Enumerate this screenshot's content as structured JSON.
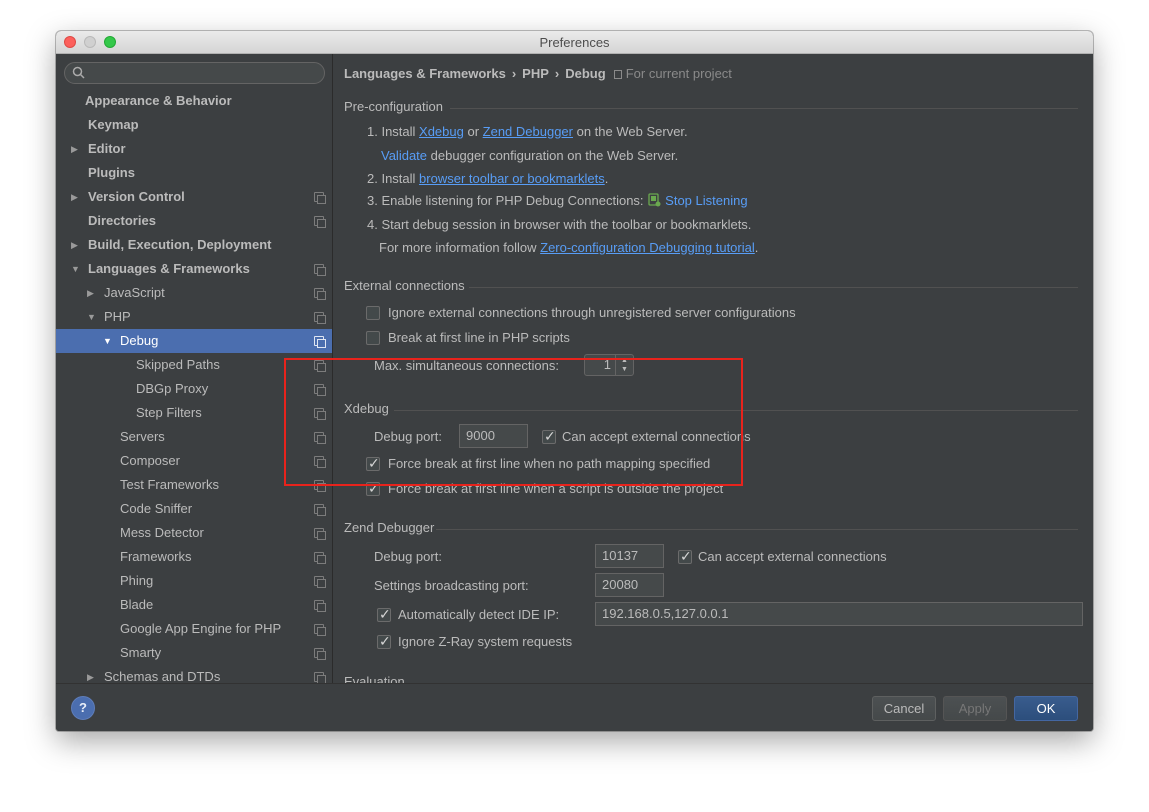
{
  "window": {
    "title": "Preferences"
  },
  "sidebar": {
    "search_placeholder": "",
    "items": [
      {
        "label": "Appearance & Behavior",
        "arrow": "",
        "bold": true
      },
      {
        "label": "Keymap",
        "arrow": "",
        "bold": true
      },
      {
        "label": "Editor",
        "arrow": "▶",
        "bold": true
      },
      {
        "label": "Plugins",
        "arrow": "",
        "bold": true
      },
      {
        "label": "Version Control",
        "arrow": "▶",
        "bold": true
      },
      {
        "label": "Directories",
        "arrow": "",
        "bold": true
      },
      {
        "label": "Build, Execution, Deployment",
        "arrow": "▶",
        "bold": true
      },
      {
        "label": "Languages & Frameworks",
        "arrow": "▼",
        "bold": true
      },
      {
        "label": "JavaScript",
        "arrow": "▶"
      },
      {
        "label": "PHP",
        "arrow": "▼"
      },
      {
        "label": "Debug",
        "arrow": "▼",
        "selected": true
      },
      {
        "label": "Skipped Paths",
        "arrow": ""
      },
      {
        "label": "DBGp Proxy",
        "arrow": ""
      },
      {
        "label": "Step Filters",
        "arrow": ""
      },
      {
        "label": "Servers",
        "arrow": ""
      },
      {
        "label": "Composer",
        "arrow": ""
      },
      {
        "label": "Test Frameworks",
        "arrow": ""
      },
      {
        "label": "Code Sniffer",
        "arrow": ""
      },
      {
        "label": "Mess Detector",
        "arrow": ""
      },
      {
        "label": "Frameworks",
        "arrow": ""
      },
      {
        "label": "Phing",
        "arrow": ""
      },
      {
        "label": "Blade",
        "arrow": ""
      },
      {
        "label": "Google App Engine for PHP",
        "arrow": ""
      },
      {
        "label": "Smarty",
        "arrow": ""
      },
      {
        "label": "Schemas and DTDs",
        "arrow": "▶"
      }
    ]
  },
  "breadcrumb": {
    "part1": "Languages & Frameworks",
    "part2": "PHP",
    "part3": "Debug",
    "sep": "›",
    "scope": "For current project"
  },
  "preconfig": {
    "title": "Pre-configuration",
    "step1_prefix": "1. Install ",
    "step1_link1": "Xdebug",
    "step1_or": " or ",
    "step1_link2": "Zend Debugger",
    "step1_suffix": " on the Web Server.",
    "validate_link": "Validate",
    "validate_suffix": " debugger configuration on the Web Server.",
    "step2_prefix": "2. Install ",
    "step2_link": "browser toolbar or bookmarklets",
    "step2_suffix": ".",
    "step3_prefix": "3. Enable listening for PHP Debug Connections: ",
    "step3_link": "Stop Listening",
    "step4": "4. Start debug session in browser with the toolbar or bookmarklets.",
    "more_prefix": "For more information follow ",
    "more_link": "Zero-configuration Debugging tutorial",
    "more_suffix": "."
  },
  "external": {
    "title": "External connections",
    "ignore_label": "Ignore external connections through unregistered server configurations",
    "ignore_checked": false,
    "break_label": "Break at first line in PHP scripts",
    "break_checked": false,
    "max_label": "Max. simultaneous connections:",
    "max_value": "1"
  },
  "xdebug": {
    "title": "Xdebug",
    "port_label": "Debug port:",
    "port_value": "9000",
    "accept_label": "Can accept external connections",
    "accept_checked": true,
    "force1_label": "Force break at first line when no path mapping specified",
    "force1_checked": true,
    "force2_label": "Force break at first line when a script is outside the project",
    "force2_checked": true
  },
  "zend": {
    "title": "Zend Debugger",
    "port_label": "Debug port:",
    "port_value": "10137",
    "accept_label": "Can accept external connections",
    "accept_checked": true,
    "broadcast_label": "Settings broadcasting port:",
    "broadcast_value": "20080",
    "detect_label": "Automatically detect IDE IP:",
    "detect_checked": true,
    "detect_value": "192.168.0.5,127.0.0.1",
    "zray_label": "Ignore Z-Ray system requests",
    "zray_checked": true
  },
  "evaluation": {
    "title": "Evaluation"
  },
  "buttons": {
    "help": "?",
    "cancel": "Cancel",
    "apply": "Apply",
    "ok": "OK"
  },
  "colors": {
    "accent": "#4b6eaf",
    "link": "#589df6",
    "highlight": "#e8231c",
    "background": "#3c3f41"
  }
}
